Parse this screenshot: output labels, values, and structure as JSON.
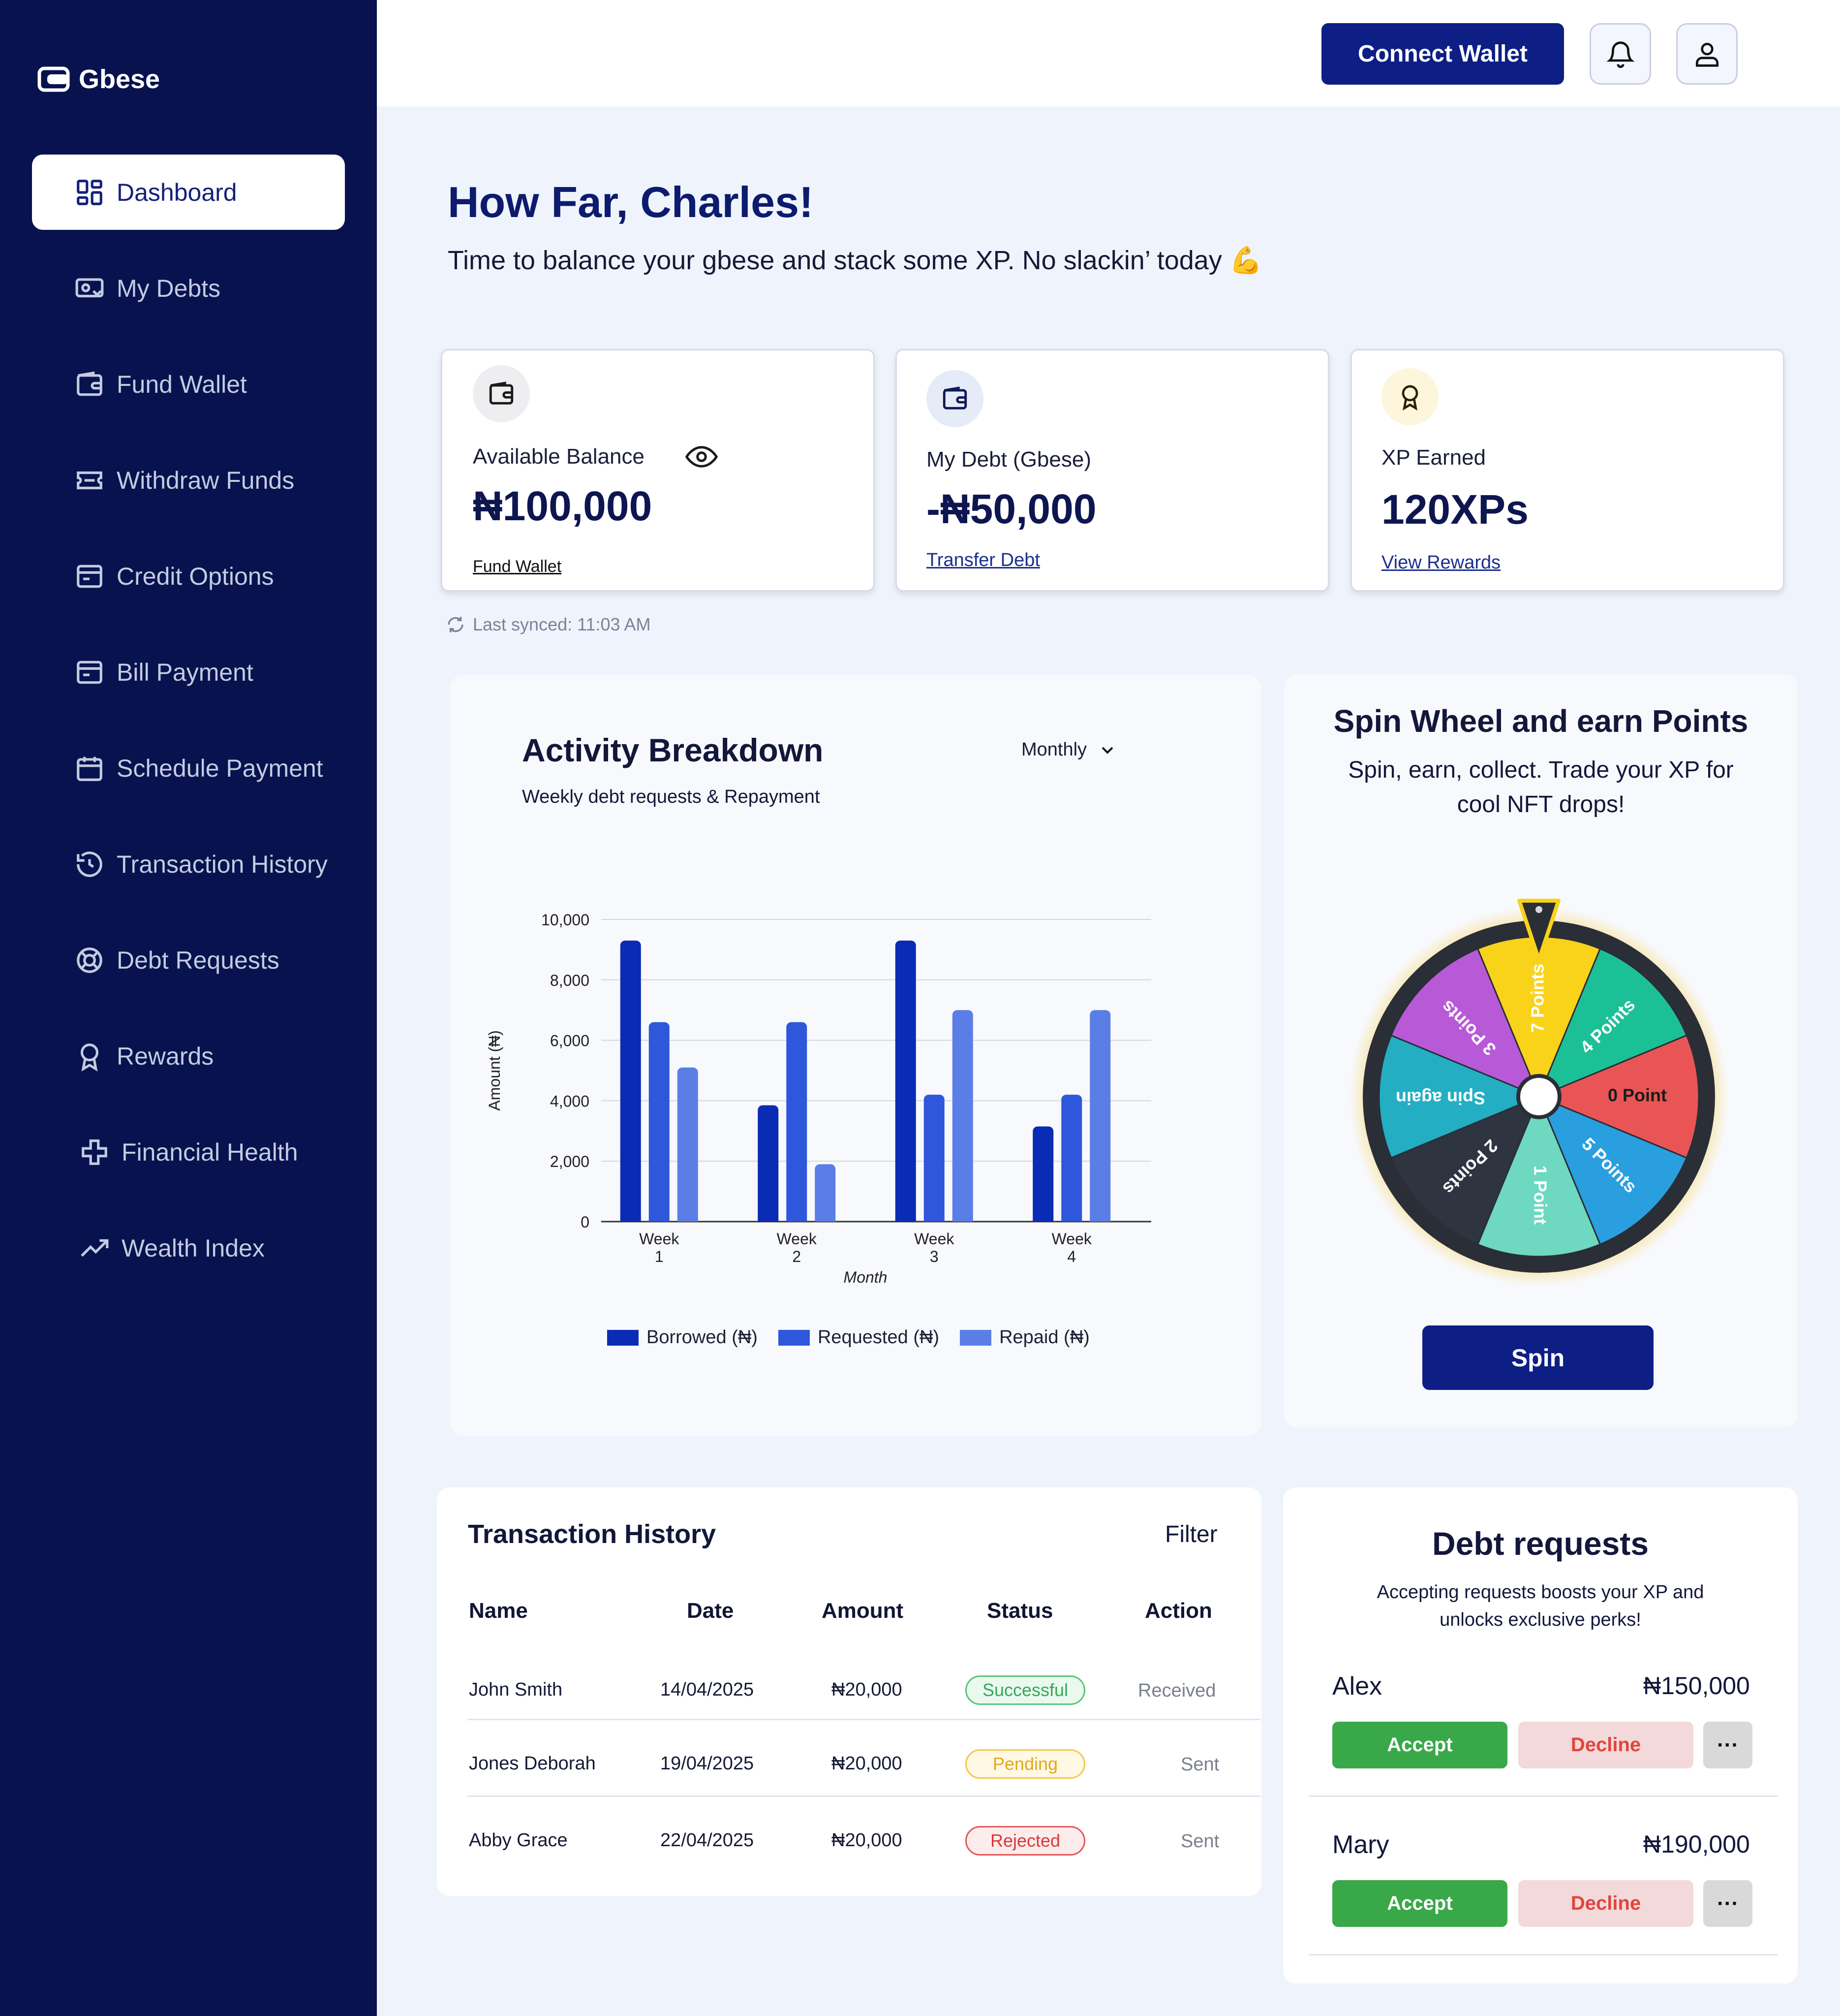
{
  "app": {
    "name": "Gbese"
  },
  "sidebar": {
    "items": [
      {
        "label": "Dashboard",
        "icon": "dashboard-grid-icon",
        "active": true
      },
      {
        "label": "My Debts",
        "icon": "debt-card-icon"
      },
      {
        "label": "Fund Wallet",
        "icon": "wallet-icon"
      },
      {
        "label": "Withdraw Funds",
        "icon": "withdraw-ticket-icon"
      },
      {
        "label": "Credit Options",
        "icon": "credit-icon"
      },
      {
        "label": "Bill Payment",
        "icon": "bill-icon"
      },
      {
        "label": "Schedule Payment",
        "icon": "calendar-icon"
      },
      {
        "label": "Transaction History",
        "icon": "history-icon"
      },
      {
        "label": "Debt Requests",
        "icon": "lifebuoy-icon"
      },
      {
        "label": "Rewards",
        "icon": "award-icon"
      },
      {
        "label": "Financial Health",
        "icon": "health-cross-icon"
      },
      {
        "label": "Wealth Index",
        "icon": "trend-up-icon"
      }
    ]
  },
  "header": {
    "connect_label": "Connect Wallet"
  },
  "greeting": {
    "title": "How Far, Charles!",
    "subtitle": "Time to balance your gbese and stack some XP. No slackin’ today 💪"
  },
  "cards": {
    "balance": {
      "label": "Available Balance",
      "value": "₦100,000",
      "link": "Fund Wallet"
    },
    "debt": {
      "label": "My Debt (Gbese)",
      "value": "-₦50,000",
      "link": "Transfer Debt"
    },
    "xp": {
      "label": "XP Earned",
      "value": "120XPs",
      "link": "View Rewards"
    }
  },
  "sync": {
    "text": "Last synced: 11:03 AM"
  },
  "activity": {
    "title": "Activity Breakdown",
    "subtitle": "Weekly debt requests & Repayment",
    "period": "Monthly"
  },
  "chart_data": {
    "type": "bar",
    "categories": [
      [
        "Week",
        "1"
      ],
      [
        "Week",
        "2"
      ],
      [
        "Week",
        "3"
      ],
      [
        "Week",
        "4"
      ]
    ],
    "series": [
      {
        "name": "Borrowed (₦)",
        "values": [
          9300,
          3850,
          9300,
          3150
        ],
        "color": "#0a2bb4"
      },
      {
        "name": "Requested (₦)",
        "values": [
          6600,
          6600,
          4200,
          4200
        ],
        "color": "#2f57dc"
      },
      {
        "name": "Repaid (₦)",
        "values": [
          5100,
          1900,
          7000,
          7000
        ],
        "color": "#5b7ee6"
      }
    ],
    "xlabel": "Month",
    "ylabel": "Amount (₦)",
    "ylim": [
      0,
      10000
    ],
    "yticks": [
      "0",
      "2,000",
      "4,000",
      "6,000",
      "8,000",
      "10,000"
    ],
    "grid": true,
    "legend": "bottom"
  },
  "spin": {
    "title": "Spin Wheel and earn Points",
    "subtitle_line1": "Spin, earn, collect. Trade your XP for",
    "subtitle_line2": "cool NFT drops!",
    "button": "Spin",
    "segments": [
      {
        "label": "7 Points",
        "color": "#f8d31a"
      },
      {
        "label": "4 Points",
        "color": "#1cc097"
      },
      {
        "label": "0 Point",
        "color": "#e95555"
      },
      {
        "label": "5 Points",
        "color": "#2a9fe0"
      },
      {
        "label": "1 Point",
        "color": "#6ed8c0"
      },
      {
        "label": "2 Points",
        "color": "#2e3440"
      },
      {
        "label": "Spin again",
        "color": "#23aec3"
      },
      {
        "label": "3 Points",
        "color": "#b85ad8"
      }
    ]
  },
  "transactions": {
    "title": "Transaction History",
    "filter": "Filter",
    "headers": [
      "Name",
      "Date",
      "Amount",
      "Status",
      "Action"
    ],
    "rows": [
      {
        "name": "John Smith",
        "date": "14/04/2025",
        "amount": "₦20,000",
        "status": "Successful",
        "action": "Received"
      },
      {
        "name": "Jones Deborah",
        "date": "19/04/2025",
        "amount": "₦20,000",
        "status": "Pending",
        "action": "Sent"
      },
      {
        "name": "Abby Grace",
        "date": "22/04/2025",
        "amount": "₦20,000",
        "status": "Rejected",
        "action": "Sent"
      }
    ]
  },
  "debt_requests": {
    "title": "Debt requests",
    "subtitle_line1": "Accepting requests boosts your XP and",
    "subtitle_line2": "unlocks exclusive perks!",
    "items": [
      {
        "name": "Alex",
        "amount": "₦150,000",
        "accept": "Accept",
        "decline": "Decline",
        "more": "···"
      },
      {
        "name": "Mary",
        "amount": "₦190,000",
        "accept": "Accept",
        "decline": "Decline",
        "more": "···"
      }
    ]
  }
}
